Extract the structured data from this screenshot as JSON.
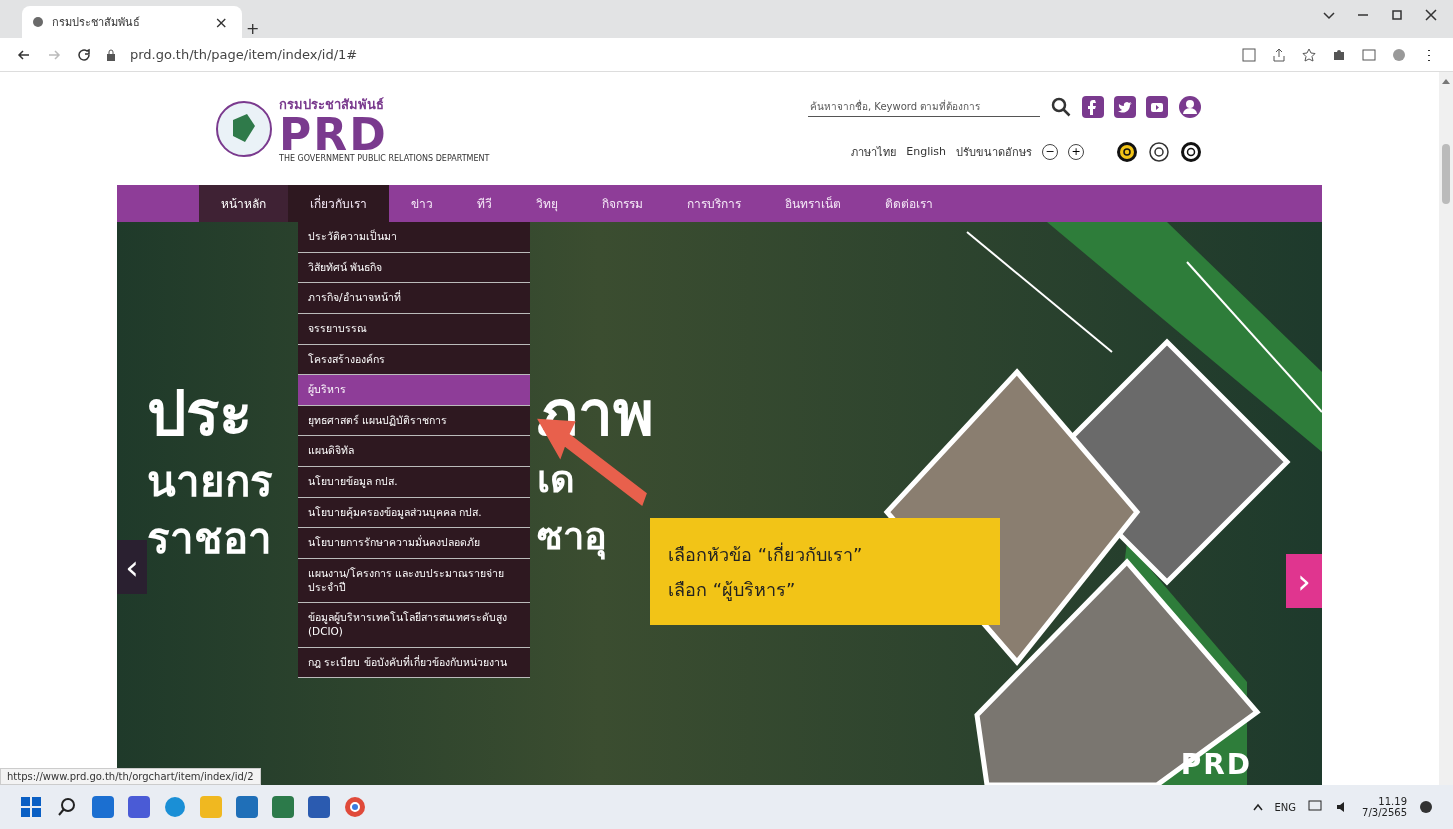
{
  "browser": {
    "tab_title": "กรมประชาสัมพันธ์",
    "tab_close": "×",
    "new_tab": "+",
    "url": "prd.go.th/th/page/item/index/id/1#"
  },
  "header": {
    "logo_thai": "กรมประชาสัมพันธ์",
    "logo_mark": "PRD",
    "logo_english": "THE GOVERNMENT PUBLIC RELATIONS DEPARTMENT",
    "search": {
      "placeholder": "ค้นหาจากชื่อ, Keyword ตามที่ต้องการ"
    },
    "lang_thai": "ภาษาไทย",
    "lang_english": "English",
    "font_size_label": "ปรับขนาดอักษร",
    "font_smaller": "−",
    "font_larger": "+"
  },
  "nav": [
    {
      "label": "หน้าหลัก",
      "selected": false,
      "current": true
    },
    {
      "label": "เกี่ยวกับเรา",
      "selected": true,
      "current": false
    },
    {
      "label": "ข่าว",
      "selected": false,
      "current": false
    },
    {
      "label": "ทีวี",
      "selected": false,
      "current": false
    },
    {
      "label": "วิทยุ",
      "selected": false,
      "current": false
    },
    {
      "label": "กิจกรรม",
      "selected": false,
      "current": false
    },
    {
      "label": "การบริการ",
      "selected": false,
      "current": false
    },
    {
      "label": "อินทราเน็ต",
      "selected": false,
      "current": false
    },
    {
      "label": "ติดต่อเรา",
      "selected": false,
      "current": false
    }
  ],
  "dropdown": [
    {
      "label": "ประวัติความเป็นมา",
      "selected": false
    },
    {
      "label": "วิสัยทัศน์ พันธกิจ",
      "selected": false
    },
    {
      "label": "ภารกิจ/อำนาจหน้าที่",
      "selected": false
    },
    {
      "label": "จรรยาบรรณ",
      "selected": false
    },
    {
      "label": "โครงสร้างองค์กร",
      "selected": false
    },
    {
      "label": "ผู้บริหาร",
      "selected": true
    },
    {
      "label": "ยุทธศาสตร์ แผนปฏิบัติราชการ",
      "selected": false
    },
    {
      "label": "แผนดิจิทัล",
      "selected": false
    },
    {
      "label": "นโยบายข้อมูล กปส.",
      "selected": false
    },
    {
      "label": "นโยบายคุ้มครองข้อมูลส่วนบุคคล กปส.",
      "selected": false
    },
    {
      "label": "นโยบายการรักษาความมั่นคงปลอดภัย",
      "selected": false
    },
    {
      "label": "แผนงาน/โครงการ และงบประมาณรายจ่ายประจำปี",
      "selected": false
    },
    {
      "label": "ข้อมูลผู้บริหารเทคโนโลยีสารสนเทศระดับสูง (DCIO)",
      "selected": false
    },
    {
      "label": "กฎ ระเบียบ ข้อบังคับที่เกี่ยวข้องกับหน่วยงาน",
      "selected": false
    }
  ],
  "hero": {
    "lines": [
      {
        "left": "ประ",
        "right": "ภาพ"
      },
      {
        "left": "นายกร",
        "right": "เด"
      },
      {
        "left": "ราชอา",
        "right": "ซาอุ"
      }
    ],
    "prev": "‹",
    "next": "›",
    "watermark": "PRD"
  },
  "callout": {
    "lines": [
      "เลือกหัวข้อ “เกี่ยวกับเรา”",
      "เลือก “ผู้บริหาร”"
    ]
  },
  "status_url": "https://www.prd.go.th/th/orgchart/item/index/id/2",
  "taskbar": {
    "language": "ENG",
    "time": "11.19",
    "date": "7/3/2565"
  }
}
